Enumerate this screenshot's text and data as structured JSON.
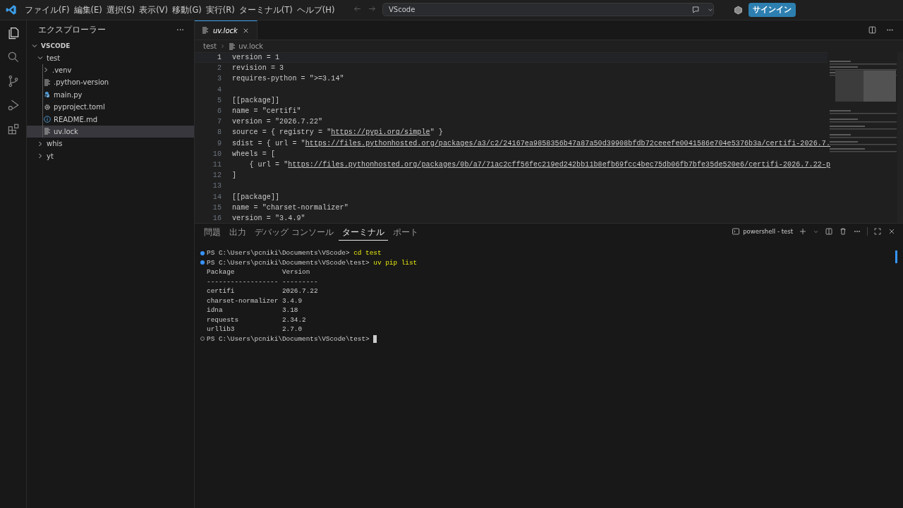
{
  "menu": [
    "ファイル(F)",
    "編集(E)",
    "選択(S)",
    "表示(V)",
    "移動(G)",
    "実行(R)",
    "ターミナル(T)",
    "ヘルプ(H)"
  ],
  "search": {
    "value": "VScode"
  },
  "sign_in": "サインイン",
  "activity_bar": [
    {
      "kind": "files",
      "selected": true
    },
    {
      "kind": "search",
      "selected": false
    },
    {
      "kind": "source-control",
      "selected": false
    },
    {
      "kind": "run",
      "selected": false
    },
    {
      "kind": "extensions",
      "selected": false
    }
  ],
  "sidebar": {
    "title": "エクスプローラー",
    "more": "···",
    "tree": [
      {
        "label": "VSCODE",
        "kind": "root",
        "expanded": true,
        "selected": false,
        "children": [
          {
            "label": "test",
            "kind": "folder",
            "expanded": true,
            "selected": false,
            "children": [
              {
                "label": ".venv",
                "kind": "folder",
                "expanded": false,
                "selected": false
              },
              {
                "label": ".python-version",
                "kind": "text",
                "selected": false
              },
              {
                "label": "main.py",
                "kind": "python",
                "selected": false
              },
              {
                "label": "pyproject.toml",
                "kind": "config",
                "selected": false
              },
              {
                "label": "README.md",
                "kind": "info",
                "selected": false
              },
              {
                "label": "uv.lock",
                "kind": "text",
                "selected": true
              }
            ]
          },
          {
            "label": "whis",
            "kind": "folder",
            "expanded": false,
            "selected": false
          },
          {
            "label": "yt",
            "kind": "folder",
            "expanded": false,
            "selected": false
          }
        ]
      }
    ]
  },
  "editor": {
    "tabs": [
      {
        "label": "uv.lock",
        "selected": true
      }
    ],
    "breadcrumb": [
      "test",
      "uv.lock"
    ],
    "lines": [
      {
        "number": "1",
        "current": true,
        "tokens": [
          {
            "kind": "text",
            "text": "version = 1"
          }
        ]
      },
      {
        "number": "2",
        "current": false,
        "tokens": [
          {
            "kind": "text",
            "text": "revision = 3"
          }
        ]
      },
      {
        "number": "3",
        "current": false,
        "tokens": [
          {
            "kind": "text",
            "text": "requires-python = \">=3.14\""
          }
        ]
      },
      {
        "number": "4",
        "current": false
      },
      {
        "number": "5",
        "current": false,
        "tokens": [
          {
            "kind": "text",
            "text": "[[package]]"
          }
        ]
      },
      {
        "number": "6",
        "current": false,
        "tokens": [
          {
            "kind": "text",
            "text": "name = \"certifi\""
          }
        ]
      },
      {
        "number": "7",
        "current": false,
        "tokens": [
          {
            "kind": "text",
            "text": "version = \"2026.7.22\""
          }
        ]
      },
      {
        "number": "8",
        "current": false,
        "tokens": [
          {
            "kind": "text",
            "text": "source = { registry = \""
          },
          {
            "kind": "link",
            "text": "https://pypi.org/simple"
          },
          {
            "kind": "text",
            "text": "\" }"
          }
        ]
      },
      {
        "number": "9",
        "current": false,
        "tokens": [
          {
            "kind": "text",
            "text": "sdist = { url = \""
          },
          {
            "kind": "link",
            "text": "https://files.pythonhosted.org/packages/a3/c2/24167ea9858356b47a87a50d39908bfdb72ceeefe0041586e704e5376b3a/certifi-2026.7."
          }
        ]
      },
      {
        "number": "10",
        "current": false,
        "tokens": [
          {
            "kind": "text",
            "text": "wheels = ["
          }
        ]
      },
      {
        "number": "11",
        "current": false,
        "tokens": [
          {
            "kind": "text",
            "text": "    { url = \""
          },
          {
            "kind": "link",
            "text": "https://files.pythonhosted.org/packages/0b/a7/71ac2cff56fec219ed242bb11b8efb69fcc4bec75db06fb7bfe35de520e6/certifi-2026.7.22-p"
          }
        ]
      },
      {
        "number": "12",
        "current": false,
        "tokens": [
          {
            "kind": "text",
            "text": "]"
          }
        ]
      },
      {
        "number": "13",
        "current": false
      },
      {
        "number": "14",
        "current": false,
        "tokens": [
          {
            "kind": "text",
            "text": "[[package]]"
          }
        ]
      },
      {
        "number": "15",
        "current": false,
        "tokens": [
          {
            "kind": "text",
            "text": "name = \"charset-normalizer\""
          }
        ]
      },
      {
        "number": "16",
        "current": false,
        "tokens": [
          {
            "kind": "text",
            "text": "version = \"3.4.9\""
          }
        ]
      }
    ]
  },
  "panel": {
    "tabs": [
      {
        "label": "問題",
        "selected": false
      },
      {
        "label": "出力",
        "selected": false
      },
      {
        "label": "デバッグ コンソール",
        "selected": false
      },
      {
        "label": "ターミナル",
        "selected": true
      },
      {
        "label": "ポート",
        "selected": false
      }
    ],
    "terminal_name": "powershell - test",
    "lines": [
      {
        "kind": "command",
        "finished": true,
        "prompt": "PS C:\\Users\\pcniki\\Documents\\VScode>",
        "command": "cd test"
      },
      {
        "kind": "command",
        "finished": true,
        "prompt": "PS C:\\Users\\pcniki\\Documents\\VScode\\test>",
        "command": "uv pip list"
      },
      {
        "kind": "output",
        "text": "Package            Version"
      },
      {
        "kind": "output",
        "text": "------------------ ---------"
      },
      {
        "kind": "output",
        "text": "certifi            2026.7.22"
      },
      {
        "kind": "output",
        "text": "charset-normalizer 3.4.9"
      },
      {
        "kind": "output",
        "text": "idna               3.18"
      },
      {
        "kind": "output",
        "text": "requests           2.34.2"
      },
      {
        "kind": "output",
        "text": "urllib3            2.7.0"
      },
      {
        "kind": "command",
        "finished": false,
        "prompt": "PS C:\\Users\\pcniki\\Documents\\VScode\\test>"
      }
    ]
  }
}
